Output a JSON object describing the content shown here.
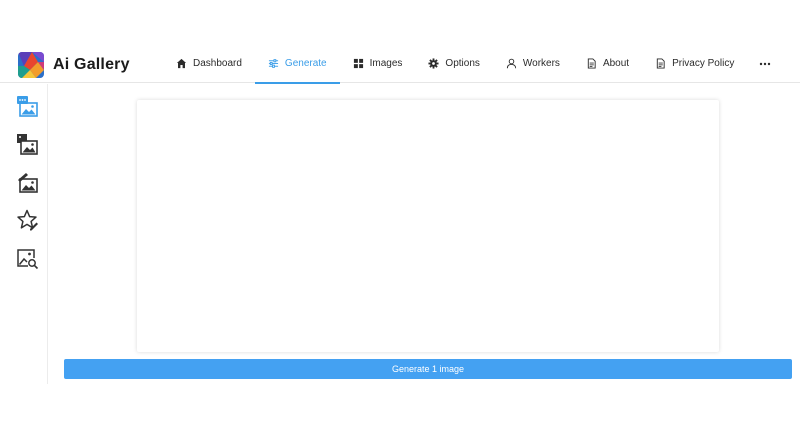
{
  "app": {
    "title": "Ai Gallery"
  },
  "nav": {
    "items": [
      {
        "label": "Dashboard",
        "icon": "home-icon",
        "active": false
      },
      {
        "label": "Generate",
        "icon": "sliders-icon",
        "active": true
      },
      {
        "label": "Images",
        "icon": "grid-icon",
        "active": false
      },
      {
        "label": "Options",
        "icon": "gear-icon",
        "active": false
      },
      {
        "label": "Workers",
        "icon": "user-icon",
        "active": false
      },
      {
        "label": "About",
        "icon": "document-icon",
        "active": false
      },
      {
        "label": "Privacy Policy",
        "icon": "document-icon",
        "active": false
      }
    ],
    "more_icon": "more-icon"
  },
  "sidebar": {
    "items": [
      {
        "icon": "text-to-image-icon",
        "active": true
      },
      {
        "icon": "image-to-image-icon",
        "active": false
      },
      {
        "icon": "inpaint-icon",
        "active": false
      },
      {
        "icon": "star-edit-icon",
        "active": false
      },
      {
        "icon": "image-search-icon",
        "active": false
      }
    ]
  },
  "generate_button": {
    "label": "Generate 1 image"
  },
  "colors": {
    "accent": "#3a9de8",
    "button": "#44a1f2"
  }
}
